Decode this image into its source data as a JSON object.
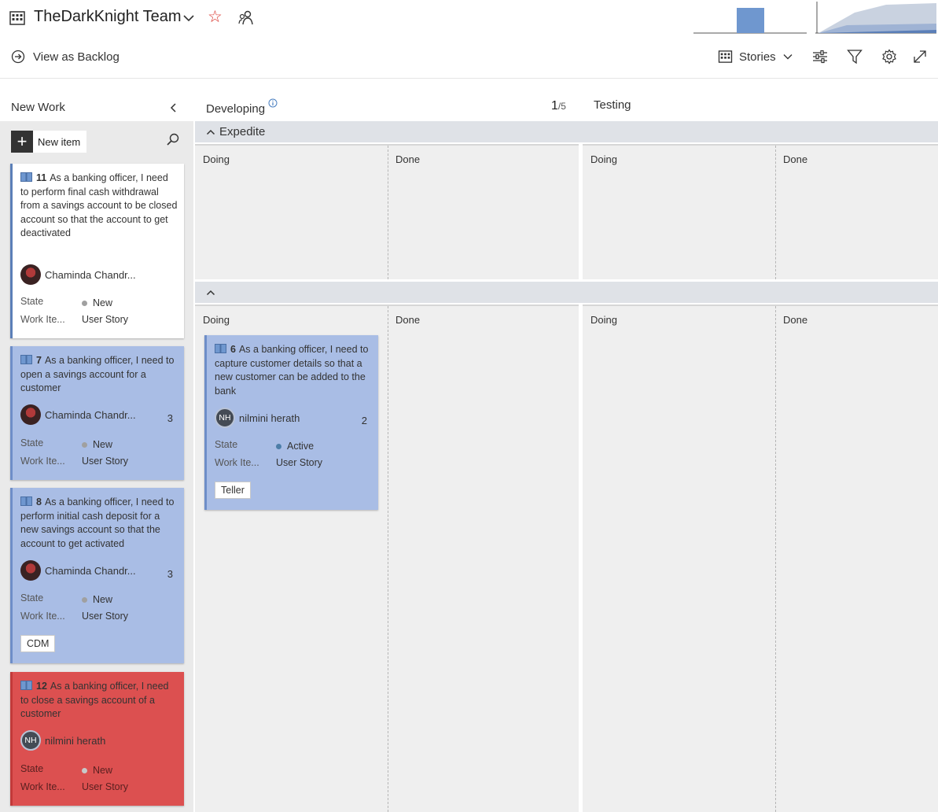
{
  "header": {
    "team_title": "TheDarkKnight Team",
    "view_as_backlog": "View as Backlog",
    "stories_label": "Stories"
  },
  "left_column": {
    "title": "New Work",
    "new_item_label": "New item"
  },
  "board": {
    "columns": [
      {
        "title": "Developing",
        "wip_current": "1",
        "wip_limit": "/5"
      },
      {
        "title": "Testing"
      }
    ],
    "lanes": [
      {
        "title": "Expedite"
      },
      {
        "title": ""
      }
    ],
    "split_labels": {
      "doing": "Doing",
      "done": "Done"
    }
  },
  "card_fields": {
    "state_label": "State",
    "work_item_label": "Work Ite..."
  },
  "cards": [
    {
      "id": "11",
      "title": "As a banking officer, I need to perform final cash withdrawal from a savings account to be closed account so that the account to get deactivated",
      "assignee": "Chaminda Chandr...",
      "effort": "",
      "state": "New",
      "work_item_type": "User Story",
      "tag": ""
    },
    {
      "id": "7",
      "title": "As a banking officer, I need to open a savings account for a customer",
      "assignee": "Chaminda Chandr...",
      "effort": "3",
      "state": "New",
      "work_item_type": "User Story",
      "tag": ""
    },
    {
      "id": "8",
      "title": "As a banking officer, I need to perform initial cash deposit for a new savings account so that the account to get activated",
      "assignee": "Chaminda Chandr...",
      "effort": "3",
      "state": "New",
      "work_item_type": "User Story",
      "tag": "CDM"
    },
    {
      "id": "12",
      "title": "As a banking officer, I need to close a savings account of a customer",
      "assignee": "nilmini herath",
      "assignee_initials": "NH",
      "effort": "",
      "state": "New",
      "work_item_type": "User Story",
      "tag": ""
    },
    {
      "id": "6",
      "title": "As a banking officer, I need to capture customer details so that a new customer can be added to the bank",
      "assignee": "nilmini herath",
      "assignee_initials": "NH",
      "effort": "2",
      "state": "Active",
      "work_item_type": "User Story",
      "tag": "Teller"
    }
  ],
  "colors": {
    "card_blue": "#a9bde5",
    "card_red": "#dc5050",
    "favorite_star": "#d9332b",
    "active_state": "#4d7ea8"
  },
  "icons": [
    "board-icon",
    "chevron-down-icon",
    "star-icon",
    "people-icon",
    "arrow-circle-icon",
    "settings-sliders-icon",
    "filter-icon",
    "gear-icon",
    "expand-icon",
    "search-icon",
    "plus-icon",
    "book-icon",
    "info-icon",
    "chevron-up-icon",
    "chevron-left-icon"
  ]
}
